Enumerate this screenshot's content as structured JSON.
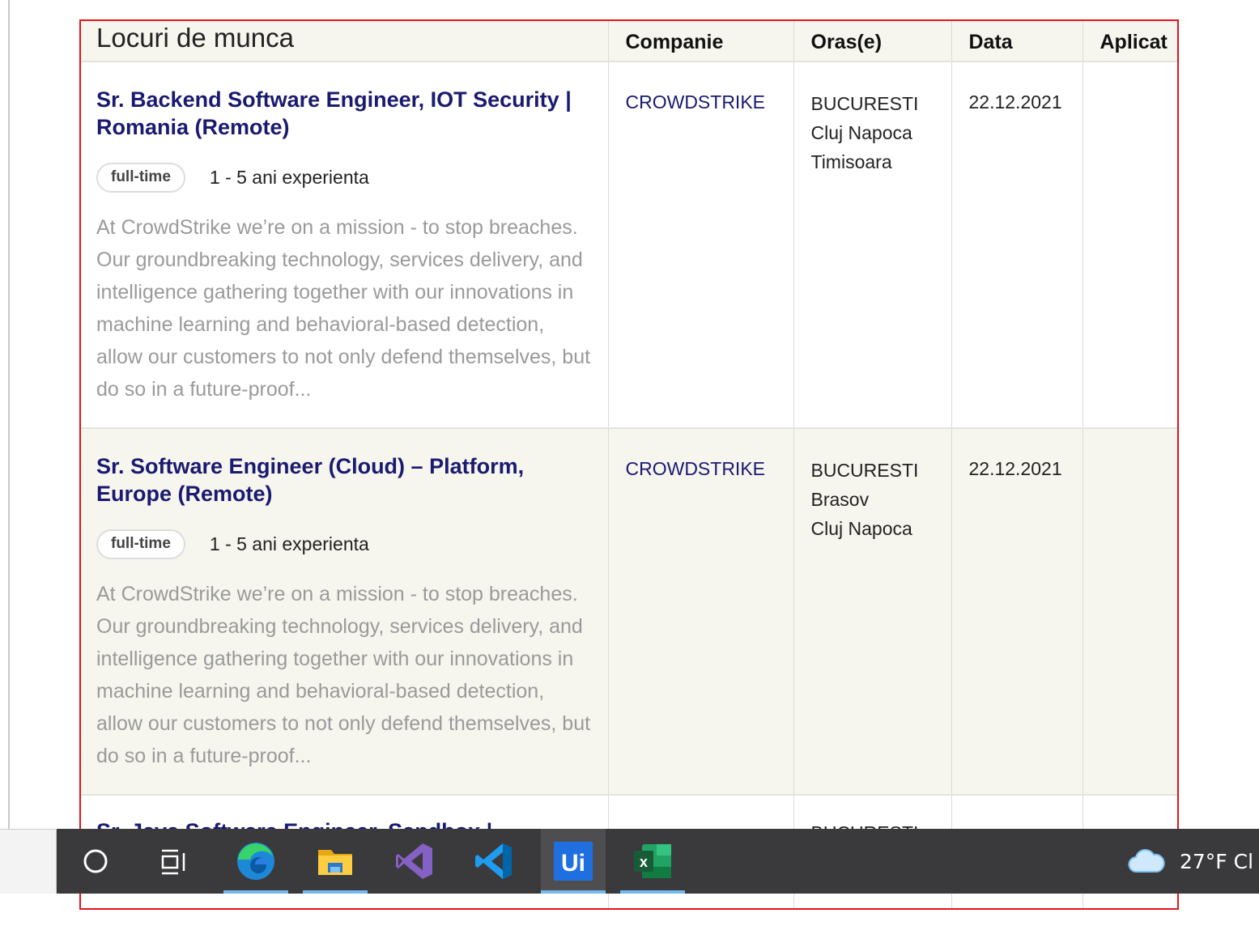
{
  "table": {
    "headers": {
      "title": "Locuri de munca",
      "company": "Companie",
      "cities": "Oras(e)",
      "date": "Data",
      "applied": "Aplicat"
    },
    "rows": [
      {
        "title": "Sr. Backend Software Engineer, IOT Security | Romania (Remote)",
        "type": "full-time",
        "experience": "1 - 5 ani experienta",
        "description": "At CrowdStrike we’re on a mission - to stop breaches. Our groundbreaking technology, services delivery, and intelligence gathering together with our innovations in machine learning and behavioral-based detection, allow our customers to not only defend themselves, but do so in a future-proof...",
        "company": "CROWDSTRIKE",
        "cities": [
          "BUCURESTI",
          "Cluj Napoca",
          "Timisoara"
        ],
        "date": "22.12.2021",
        "applied": ""
      },
      {
        "title": "Sr. Software Engineer (Cloud) – Platform, Europe (Remote)",
        "type": "full-time",
        "experience": "1 - 5 ani experienta",
        "description": "At CrowdStrike we’re on a mission - to stop breaches. Our groundbreaking technology, services delivery, and intelligence gathering together with our innovations in machine learning and behavioral-based detection, allow our customers to not only defend themselves, but do so in a future-proof...",
        "company": "CROWDSTRIKE",
        "cities": [
          "BUCURESTI",
          "Brasov",
          "Cluj Napoca"
        ],
        "date": "22.12.2021",
        "applied": ""
      }
    ],
    "partial_row": {
      "title": "Sr. Java Software Engineer, Sandbox |",
      "city": "BUCURESTI"
    }
  },
  "taskbar": {
    "icons": [
      "search-circle-icon",
      "task-view-icon",
      "edge-icon",
      "file-explorer-icon",
      "visual-studio-icon",
      "vscode-icon",
      "uipath-icon",
      "excel-icon"
    ],
    "weather_icon": "cloud-icon",
    "weather_text": "27°F  Cl"
  }
}
